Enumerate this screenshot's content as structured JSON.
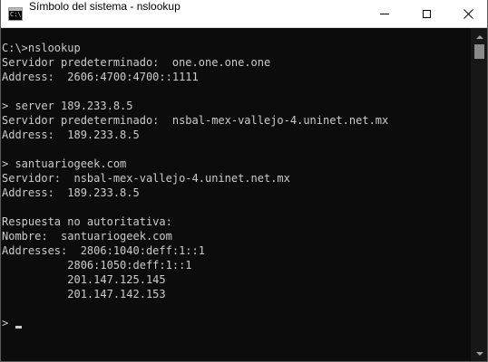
{
  "window": {
    "title": "Símbolo del sistema - nslookup",
    "icon": "cmd-icon",
    "buttons": {
      "minimize": "minimize-icon",
      "maximize": "maximize-icon",
      "close": "close-icon"
    }
  },
  "console": {
    "lines": [
      "C:\\>nslookup",
      "Servidor predeterminado:  one.one.one.one",
      "Address:  2606:4700:4700::1111",
      "",
      "> server 189.233.8.5",
      "Servidor predeterminado:  nsbal-mex-vallejo-4.uninet.net.mx",
      "Address:  189.233.8.5",
      "",
      "> santuariogeek.com",
      "Servidor:  nsbal-mex-vallejo-4.uninet.net.mx",
      "Address:  189.233.8.5",
      "",
      "Respuesta no autoritativa:",
      "Nombre:  santuariogeek.com",
      "Addresses:  2806:1040:deff:1::1",
      "          2806:1050:deff:1::1",
      "          201.147.125.145",
      "          201.147.142.153",
      "",
      "> "
    ]
  },
  "colors": {
    "console_bg": "#0c0c0c",
    "console_text": "#cccccc",
    "titlebar_bg": "#ffffff"
  }
}
